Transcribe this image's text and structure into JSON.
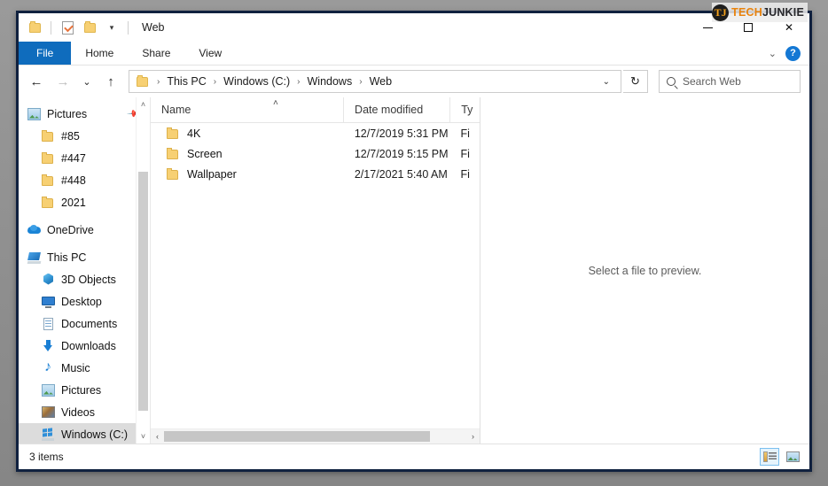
{
  "window": {
    "title": "Web",
    "quick_access": [
      "folder-icon",
      "properties-icon",
      "new-folder-icon",
      "customize-caret"
    ],
    "controls": {
      "minimize": "–",
      "maximize": "□",
      "close": "✕"
    }
  },
  "watermark": {
    "logo": "TJ",
    "tech": "TECH",
    "junkie": "JUNKIE"
  },
  "ribbon": {
    "tabs": [
      {
        "label": "File",
        "active": true
      },
      {
        "label": "Home",
        "active": false
      },
      {
        "label": "Share",
        "active": false
      },
      {
        "label": "View",
        "active": false
      }
    ],
    "expand_caret": "⌄",
    "help_label": "?"
  },
  "address_bar": {
    "back": "←",
    "forward": "→",
    "recent": "⌄",
    "up": "↑",
    "breadcrumb": [
      "This PC",
      "Windows (C:)",
      "Windows",
      "Web"
    ],
    "separator": "›",
    "dropdown": "⌄",
    "refresh": "↻"
  },
  "search": {
    "placeholder": "Search Web",
    "icon": "search-icon"
  },
  "nav_pane": {
    "items": [
      {
        "label": "Pictures",
        "icon": "pictures-icon",
        "indent": 0,
        "pinned": true,
        "selected": false
      },
      {
        "label": "#85",
        "icon": "folder-icon",
        "indent": 1,
        "pinned": false,
        "selected": false
      },
      {
        "label": "#447",
        "icon": "folder-icon",
        "indent": 1,
        "pinned": false,
        "selected": false
      },
      {
        "label": "#448",
        "icon": "folder-icon",
        "indent": 1,
        "pinned": false,
        "selected": false
      },
      {
        "label": "2021",
        "icon": "folder-icon",
        "indent": 1,
        "pinned": false,
        "selected": false
      },
      {
        "label": "OneDrive",
        "icon": "onedrive-icon",
        "indent": 0,
        "pinned": false,
        "selected": false
      },
      {
        "label": "This PC",
        "icon": "this-pc-icon",
        "indent": 0,
        "pinned": false,
        "selected": false
      },
      {
        "label": "3D Objects",
        "icon": "3d-objects-icon",
        "indent": 1,
        "pinned": false,
        "selected": false
      },
      {
        "label": "Desktop",
        "icon": "desktop-icon",
        "indent": 1,
        "pinned": false,
        "selected": false
      },
      {
        "label": "Documents",
        "icon": "documents-icon",
        "indent": 1,
        "pinned": false,
        "selected": false
      },
      {
        "label": "Downloads",
        "icon": "downloads-icon",
        "indent": 1,
        "pinned": false,
        "selected": false
      },
      {
        "label": "Music",
        "icon": "music-icon",
        "indent": 1,
        "pinned": false,
        "selected": false
      },
      {
        "label": "Pictures",
        "icon": "pictures-icon",
        "indent": 1,
        "pinned": false,
        "selected": false
      },
      {
        "label": "Videos",
        "icon": "videos-icon",
        "indent": 1,
        "pinned": false,
        "selected": false
      },
      {
        "label": "Windows (C:)",
        "icon": "windows-drive-icon",
        "indent": 1,
        "pinned": false,
        "selected": true
      }
    ],
    "scroll_up": "˄",
    "scroll_down": "˅"
  },
  "file_list": {
    "columns": [
      {
        "key": "name",
        "label": "Name"
      },
      {
        "key": "date",
        "label": "Date modified"
      },
      {
        "key": "type",
        "label": "Ty"
      }
    ],
    "sort_indicator": "˄",
    "rows": [
      {
        "name": "4K",
        "date": "12/7/2019 5:31 PM",
        "type": "Fi",
        "icon": "folder-icon"
      },
      {
        "name": "Screen",
        "date": "12/7/2019 5:15 PM",
        "type": "Fi",
        "icon": "folder-icon"
      },
      {
        "name": "Wallpaper",
        "date": "2/17/2021 5:40 AM",
        "type": "Fi",
        "icon": "folder-icon"
      }
    ],
    "hscroll_left": "‹",
    "hscroll_right": "›"
  },
  "preview": {
    "message": "Select a file to preview."
  },
  "status_bar": {
    "text": "3 items",
    "view_buttons": [
      {
        "name": "details-view",
        "active": true
      },
      {
        "name": "large-icons-view",
        "active": false
      }
    ]
  },
  "colors": {
    "accent": "#0f6cbd",
    "folder": "#f7d073",
    "selection": "#dcdcdc",
    "window_border": "#10213f",
    "watermark_orange": "#e8820c"
  }
}
